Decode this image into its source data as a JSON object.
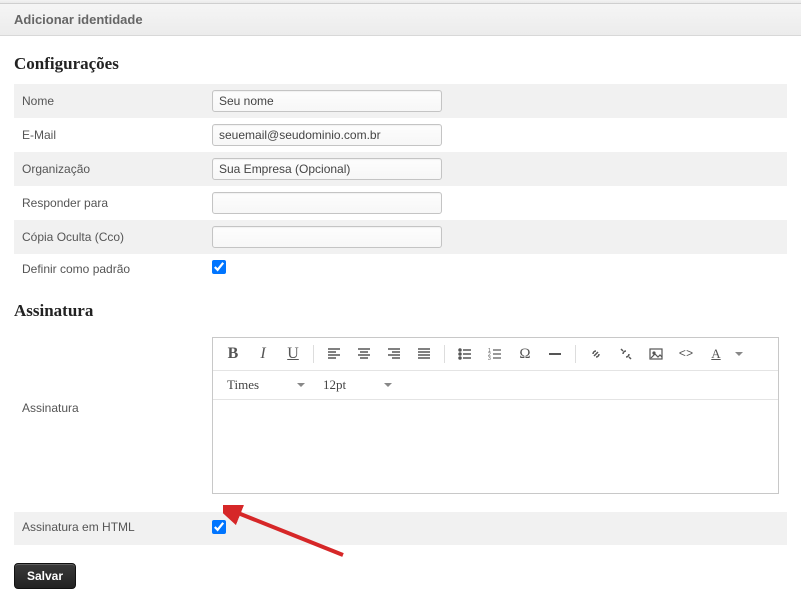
{
  "header": {
    "title": "Adicionar identidade"
  },
  "config": {
    "title": "Configurações",
    "fields": {
      "name_label": "Nome",
      "name_value": "Seu nome",
      "email_label": "E-Mail",
      "email_value": "seuemail@seudominio.com.br",
      "org_label": "Organização",
      "org_value": "Sua Empresa (Opcional)",
      "replyto_label": "Responder para",
      "replyto_value": "",
      "bcc_label": "Cópia Oculta (Cco)",
      "bcc_value": "",
      "default_label": "Definir como padrão",
      "default_checked": true
    }
  },
  "signature": {
    "title": "Assinatura",
    "label": "Assinatura",
    "html_label": "Assinatura em HTML",
    "html_checked": true,
    "font_family": "Times",
    "font_size": "12pt"
  },
  "save_label": "Salvar",
  "colors": {
    "arrow": "#d62728"
  }
}
